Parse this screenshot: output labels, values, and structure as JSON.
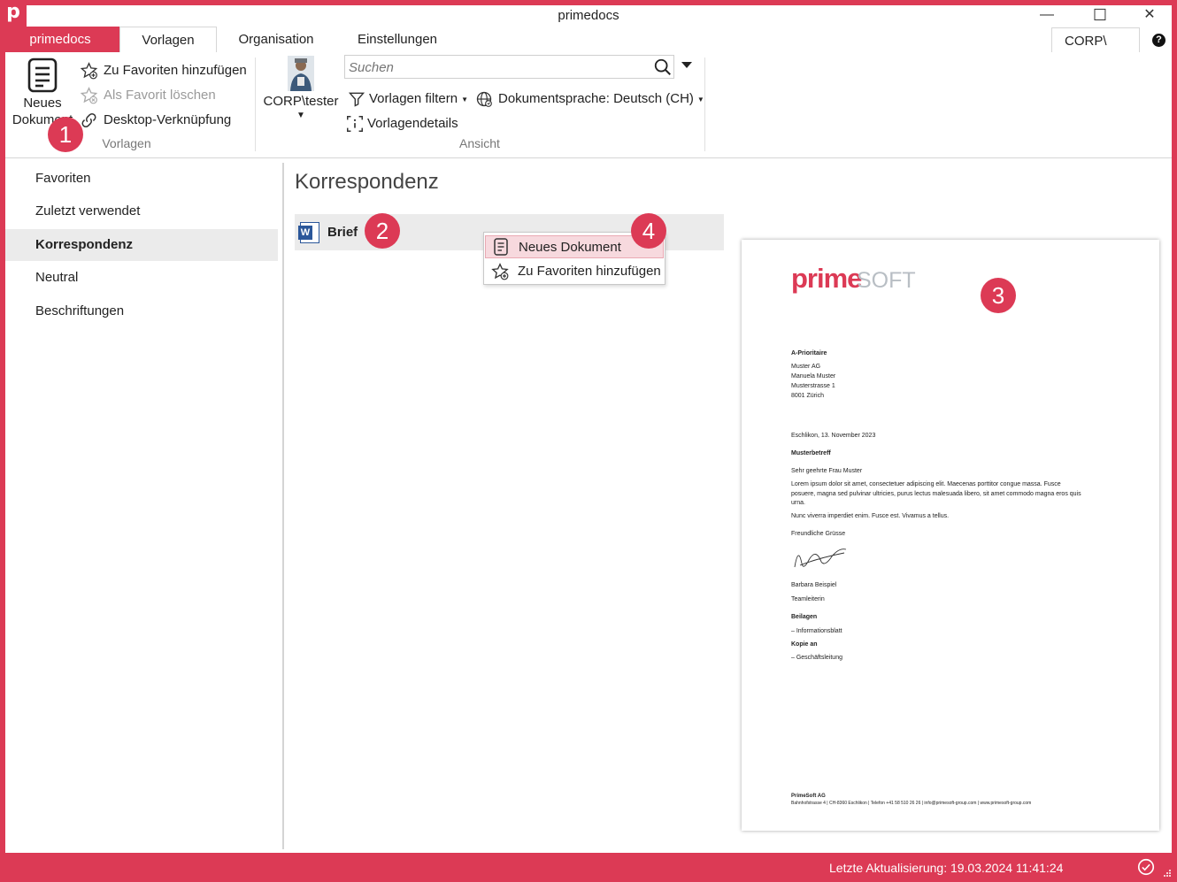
{
  "window": {
    "title": "primedocs",
    "logo_letter": "p",
    "minimize": "—",
    "maximize": "☐",
    "close": "✕"
  },
  "tabs": [
    {
      "label": "primedocs"
    },
    {
      "label": "Vorlagen"
    },
    {
      "label": "Organisation"
    },
    {
      "label": "Einstellungen"
    }
  ],
  "org_box": "CORP\\",
  "help_glyph": "?",
  "ribbon": {
    "new_doc_line1": "Neues",
    "new_doc_line2": "Dokument",
    "add_fav": "Zu Favoriten hinzufügen",
    "remove_fav": "Als Favorit löschen",
    "desktop_link": "Desktop-Verknüpfung",
    "group_vorlagen": "Vorlagen",
    "user": "CORP\\tester",
    "search_placeholder": "Suchen",
    "filter": "Vorlagen filtern",
    "language": "Dokumentsprache: Deutsch (CH)",
    "details": "Vorlagendetails",
    "group_ansicht": "Ansicht"
  },
  "sidebar": {
    "items": [
      {
        "label": "Favoriten"
      },
      {
        "label": "Zuletzt verwendet"
      },
      {
        "label": "Korrespondenz"
      },
      {
        "label": "Neutral"
      },
      {
        "label": "Beschriftungen"
      }
    ]
  },
  "main": {
    "section_title": "Korrespondenz",
    "template_name": "Brief",
    "word_glyph": "W"
  },
  "context_menu": [
    {
      "label": "Neues Dokument"
    },
    {
      "label": "Zu Favoriten hinzufügen"
    }
  ],
  "badges": [
    "1",
    "2",
    "3",
    "4"
  ],
  "preview": {
    "logo_prime": "prime",
    "logo_soft": "SOFT",
    "shipping": "A-Prioritaire",
    "address": [
      "Muster AG",
      "Manuela Muster",
      "Musterstrasse 1",
      "8001 Zürich"
    ],
    "date_line": "Eschlikon, 13. November 2023",
    "subject": "Musterbetreff",
    "salutation": "Sehr geehrte Frau Muster",
    "body": [
      "Lorem ipsum dolor sit amet, consectetuer adipiscing elit. Maecenas porttitor congue massa. Fusce",
      "posuere, magna sed pulvinar ultricies, purus lectus malesuada libero, sit amet commodo magna eros quis",
      "urna."
    ],
    "body2": "Nunc viverra imperdiet enim. Fusce est. Vivamus a tellus.",
    "closing": "Freundliche Grüsse",
    "signer_name": "Barbara Beispiel",
    "signer_role": "Teamleiterin",
    "enclosures_label": "Beilagen",
    "enclosures": "– Informationsblatt",
    "copy_label": "Kopie an",
    "copy": "– Geschäftsleitung",
    "footer_company": "PrimeSoft AG",
    "footer_line": "Bahnhofstrasse 4 | CH-8360 Eschlikon | Telefon +41 58 510 26 26 | info@primesoft-group.com | www.primesoft-group.com"
  },
  "status": {
    "last_update": "Letzte Aktualisierung: 19.03.2024 11:41:24"
  },
  "colors": {
    "accent": "#dc3a55",
    "selection": "#ebebeb",
    "menu_highlight": "#f7d9de"
  }
}
